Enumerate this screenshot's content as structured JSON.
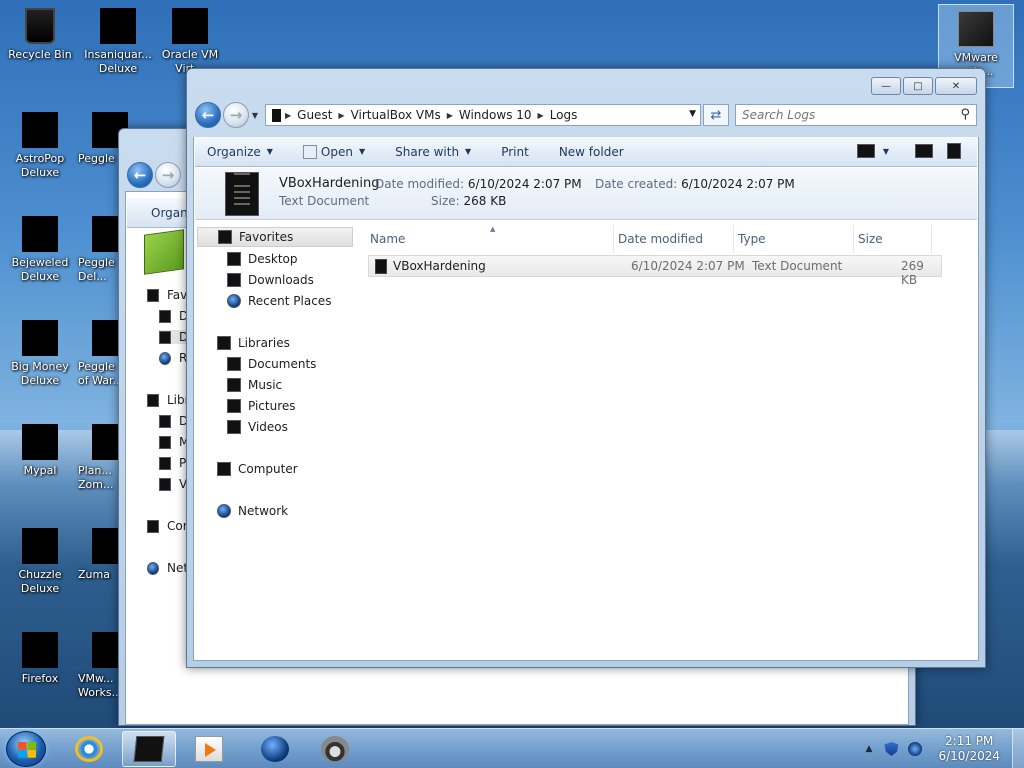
{
  "desktop": {
    "icons": [
      {
        "label": "Recycle Bin"
      },
      {
        "label": "Insaniquar... Deluxe"
      },
      {
        "label": "Oracle VM Virt..."
      },
      {
        "label": "AstroPop Deluxe"
      },
      {
        "label": "Peggle"
      },
      {
        "label": "Bejeweled Deluxe"
      },
      {
        "label": "Peggle Del..."
      },
      {
        "label": "Big Money Deluxe"
      },
      {
        "label": "Peggle of War..."
      },
      {
        "label": "Mypal"
      },
      {
        "label": "Plan... Zom..."
      },
      {
        "label": "Chuzzle Deluxe"
      },
      {
        "label": "Zuma"
      },
      {
        "label": "Firefox"
      },
      {
        "label": "VMw... Works..."
      },
      {
        "label": "VMware ...tio..."
      }
    ]
  },
  "explorer": {
    "breadcrumb": [
      "Guest",
      "VirtualBox VMs",
      "Windows 10",
      "Logs"
    ],
    "search_placeholder": "Search Logs",
    "toolbar": {
      "organize": "Organize",
      "open": "Open",
      "share_with": "Share with",
      "print": "Print",
      "new_folder": "New folder"
    },
    "details": {
      "name": "VBoxHardening",
      "type": "Text Document",
      "date_modified_label": "Date modified:",
      "date_modified": "6/10/2024 2:07 PM",
      "date_created_label": "Date created:",
      "date_created": "6/10/2024 2:07 PM",
      "size_label": "Size:",
      "size": "268 KB"
    },
    "nav": {
      "favorites": "Favorites",
      "desktop": "Desktop",
      "downloads": "Downloads",
      "recent_places": "Recent Places",
      "libraries": "Libraries",
      "documents": "Documents",
      "music": "Music",
      "pictures": "Pictures",
      "videos": "Videos",
      "computer": "Computer",
      "network": "Network"
    },
    "columns": {
      "name": "Name",
      "date_modified": "Date modified",
      "type": "Type",
      "size": "Size"
    },
    "files": [
      {
        "name": "VBoxHardening",
        "date_modified": "6/10/2024 2:07 PM",
        "type": "Text Document",
        "size": "269 KB"
      }
    ]
  },
  "back_window": {
    "organize": "Organiz",
    "nav": [
      "Fave",
      "De",
      "De",
      "Re",
      "Libr",
      "De",
      "M",
      "Pi",
      "Vi",
      "Cor",
      "Net"
    ]
  },
  "taskbar": {
    "time": "2:11 PM",
    "date": "6/10/2024"
  }
}
